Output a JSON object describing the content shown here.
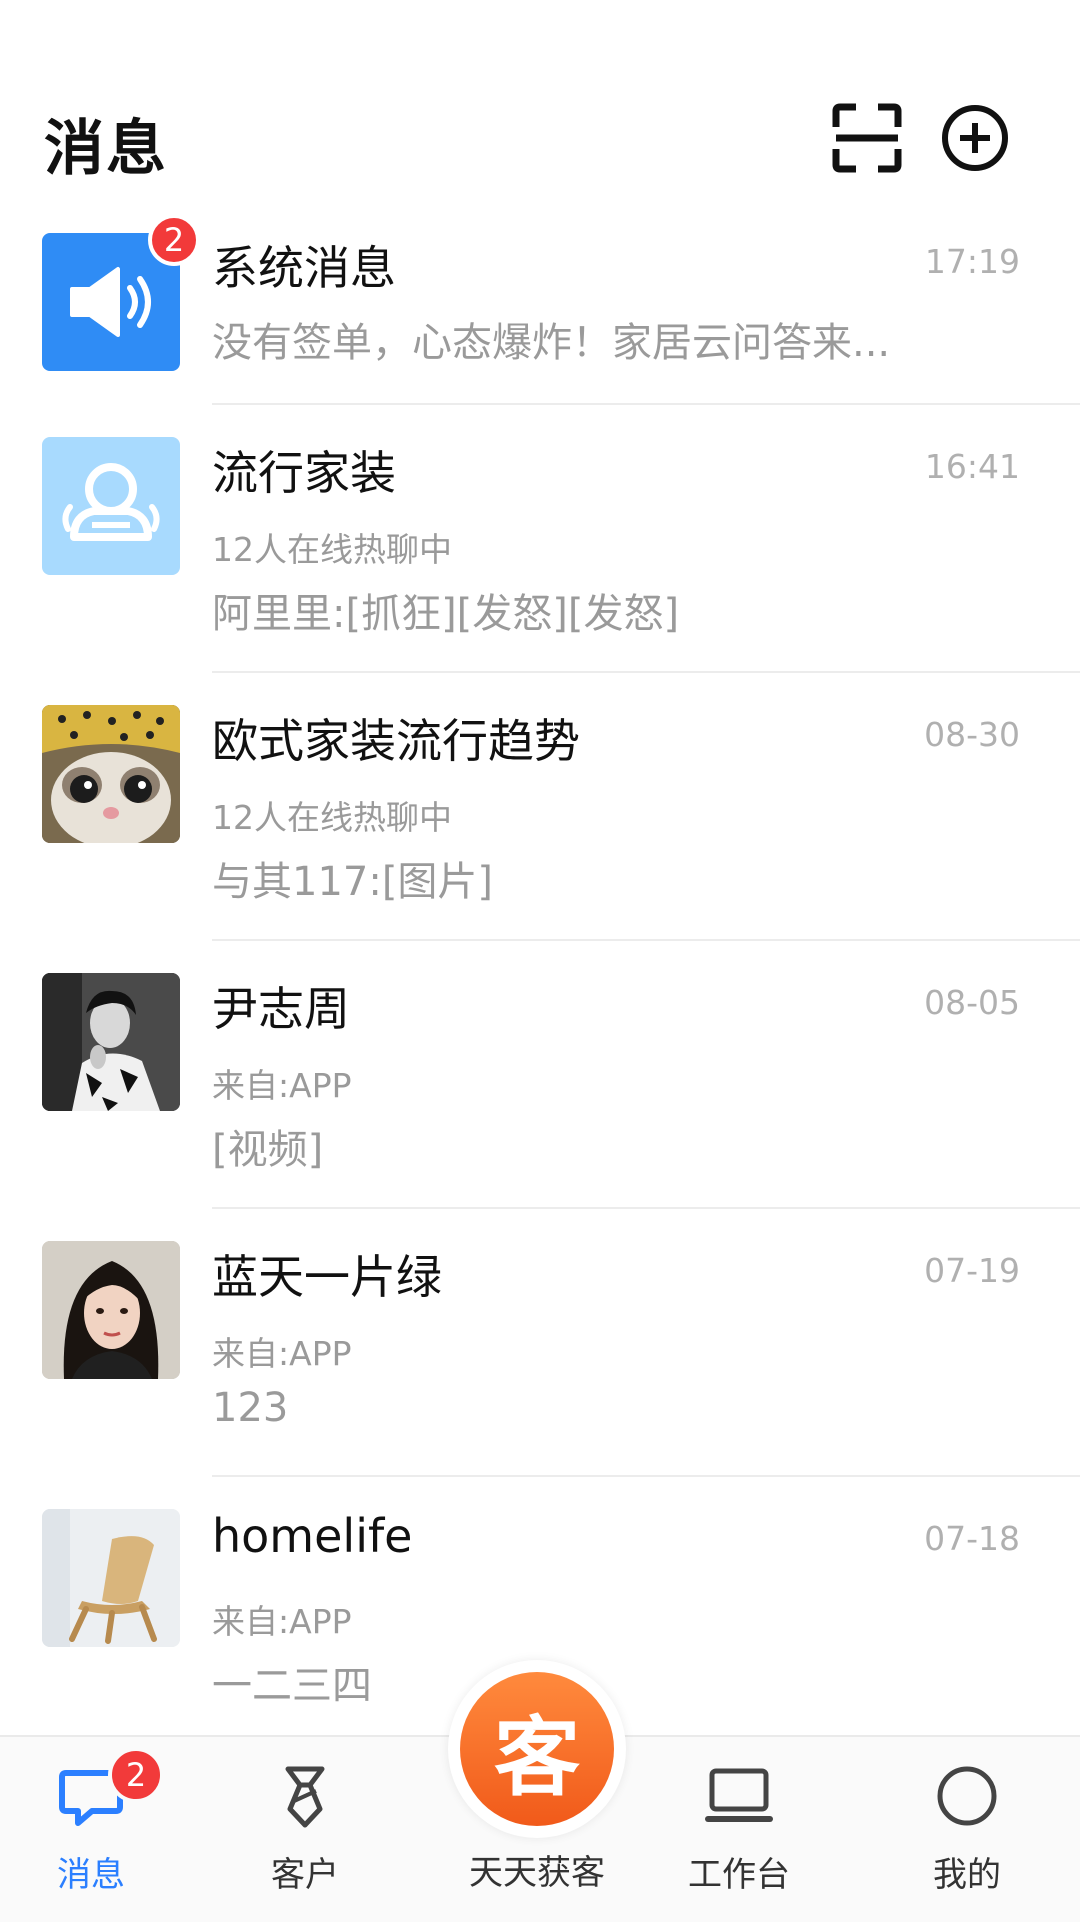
{
  "header": {
    "title": "消息",
    "scan_icon": "scan-icon",
    "add_icon": "add-circle-icon"
  },
  "messages": [
    {
      "name": "系统消息",
      "time": "17:19",
      "subtitle": "",
      "preview": "没有签单，心态爆炸！家居云问答来...",
      "badge": "2",
      "avatar": "speaker-icon"
    },
    {
      "name": "流行家装",
      "time": "16:41",
      "subtitle": "12人在线热聊中",
      "preview": "阿里里:[抓狂][发怒][发怒]",
      "avatar": "group-icon"
    },
    {
      "name": "欧式家装流行趋势",
      "time": "08-30",
      "subtitle": "12人在线热聊中",
      "preview": "与其117:[图片]",
      "avatar": "cat-photo"
    },
    {
      "name": "尹志周",
      "time": "08-05",
      "subtitle": "来自:APP",
      "preview": "[视频]",
      "avatar": "woman-photo-bw"
    },
    {
      "name": "蓝天一片绿",
      "time": "07-19",
      "subtitle": "来自:APP",
      "preview": "123",
      "avatar": "woman-photo"
    },
    {
      "name": "homelife",
      "time": "07-18",
      "subtitle": "来自:APP",
      "preview": "一二三四",
      "avatar": "chair-photo"
    }
  ],
  "tabbar": {
    "tabs": [
      {
        "label": "消息",
        "icon": "chat-icon",
        "badge": "2",
        "active": true
      },
      {
        "label": "客户",
        "icon": "tie-icon"
      },
      {
        "label": "天天获客",
        "icon": "center-ke",
        "center_text": "客"
      },
      {
        "label": "工作台",
        "icon": "laptop-icon"
      },
      {
        "label": "我的",
        "icon": "profile-circle-icon"
      }
    ]
  },
  "colors": {
    "accent": "#2b7fff",
    "badge": "#f23a3a",
    "center_button": "#f4671f"
  }
}
